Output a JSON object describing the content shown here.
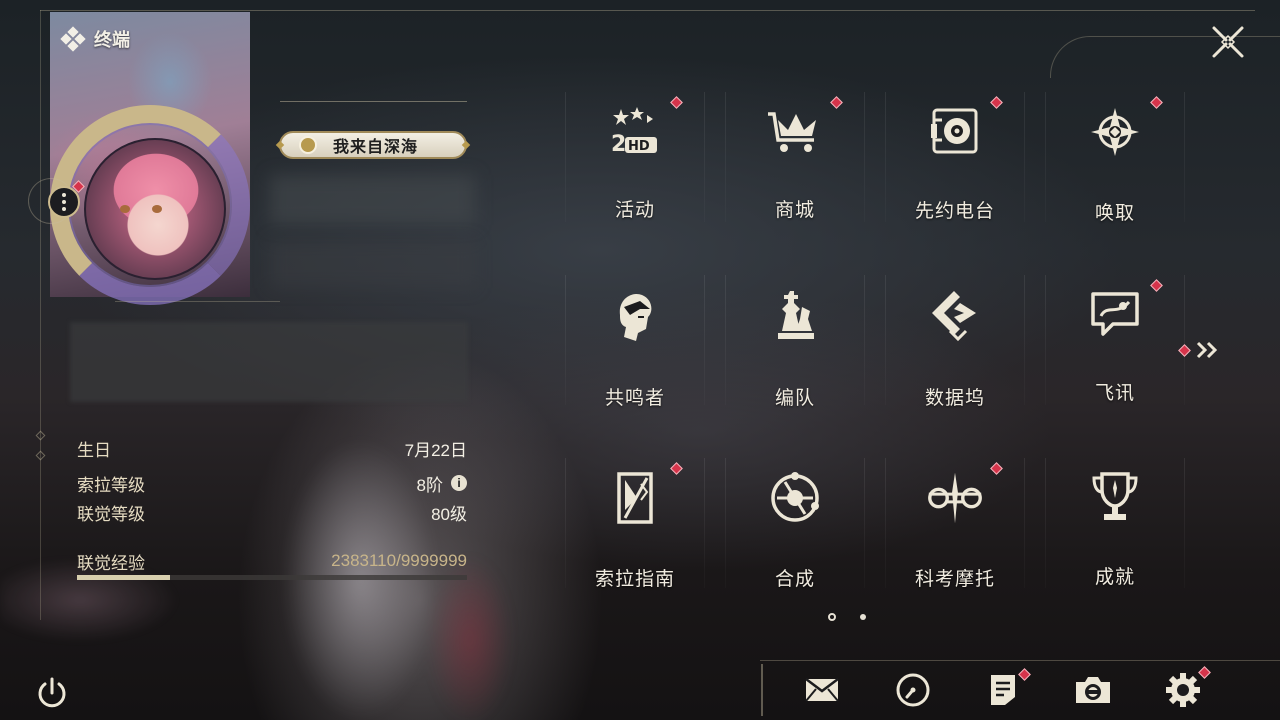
{
  "header": {
    "terminal_label": "终端"
  },
  "profile": {
    "title_badge": "我来自深海",
    "info": [
      {
        "key": "生日",
        "value": "7月22日"
      },
      {
        "key": "索拉等级",
        "value": "8阶"
      },
      {
        "key": "联觉等级",
        "value": "80级"
      }
    ],
    "exp": {
      "key": "联觉经验",
      "value": "2383110/9999999",
      "fraction": 0.238
    }
  },
  "menu": {
    "items": [
      {
        "label": "活动",
        "icon": "event-2hd-icon",
        "badge": true
      },
      {
        "label": "商城",
        "icon": "crown-cart-icon",
        "badge": true
      },
      {
        "label": "先约电台",
        "icon": "radio-turntable-icon",
        "badge": true
      },
      {
        "label": "唤取",
        "icon": "compass-star-icon",
        "badge": true
      },
      {
        "label": "共鸣者",
        "icon": "character-head-icon",
        "badge": false
      },
      {
        "label": "编队",
        "icon": "chess-pieces-icon",
        "badge": false
      },
      {
        "label": "数据坞",
        "icon": "data-dock-icon",
        "badge": false
      },
      {
        "label": "飞讯",
        "icon": "chat-bubble-icon",
        "badge": true
      },
      {
        "label": "索拉指南",
        "icon": "guide-book-icon",
        "badge": true
      },
      {
        "label": "合成",
        "icon": "synthesis-orb-icon",
        "badge": false
      },
      {
        "label": "科考摩托",
        "icon": "motorbike-icon",
        "badge": true
      },
      {
        "label": "成就",
        "icon": "trophy-icon",
        "badge": false
      }
    ]
  },
  "bottom_bar": {
    "buttons": [
      {
        "icon": "mail-icon",
        "badge": false
      },
      {
        "icon": "clock-icon",
        "badge": false
      },
      {
        "icon": "notice-icon",
        "badge": true
      },
      {
        "icon": "camera-icon",
        "badge": false
      },
      {
        "icon": "settings-gear-icon",
        "badge": true
      }
    ]
  },
  "colors": {
    "badge_red": "#d6344b",
    "gold": "#c9b78a",
    "text": "#f1ece0"
  }
}
